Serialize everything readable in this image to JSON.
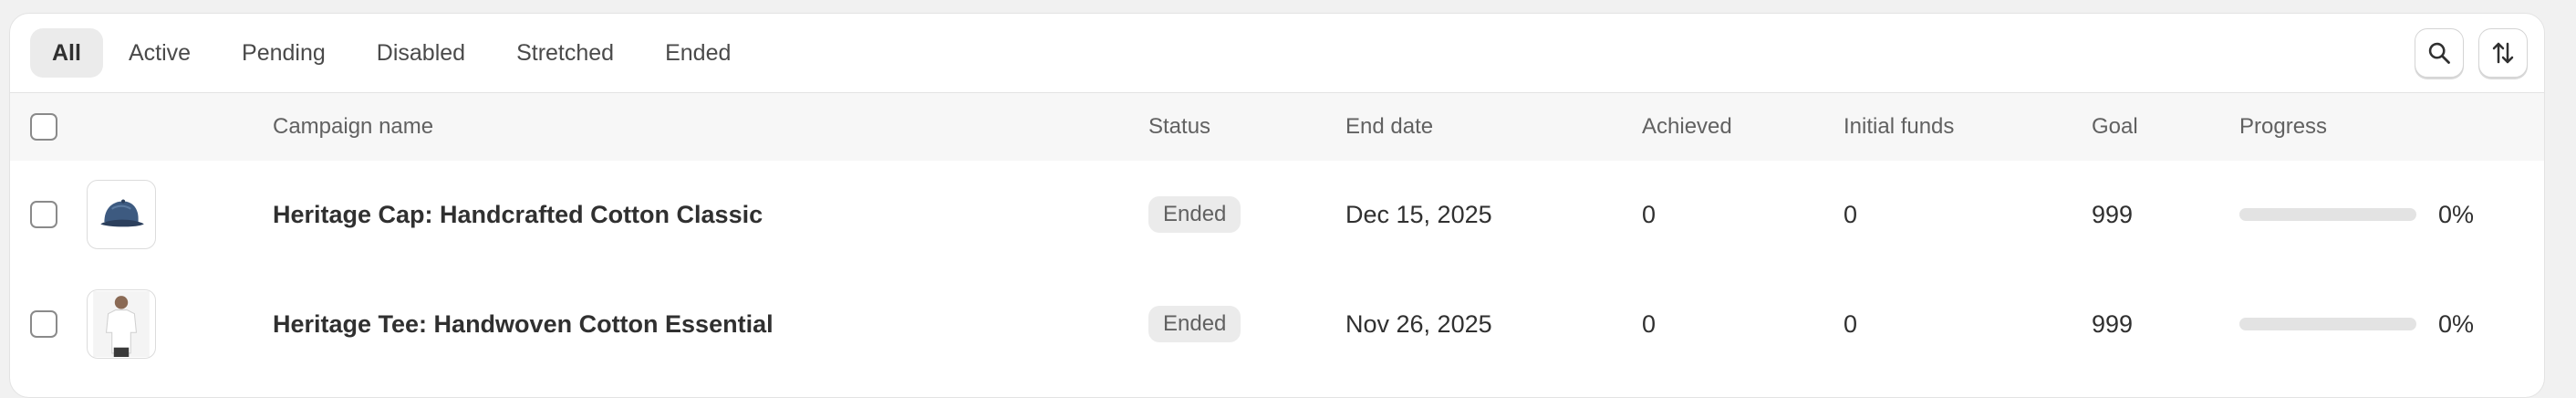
{
  "tabs": [
    {
      "label": "All",
      "active": true
    },
    {
      "label": "Active",
      "active": false
    },
    {
      "label": "Pending",
      "active": false
    },
    {
      "label": "Disabled",
      "active": false
    },
    {
      "label": "Stretched",
      "active": false
    },
    {
      "label": "Ended",
      "active": false
    }
  ],
  "toolbar": {
    "search_icon": "search-icon",
    "sort_icon": "sort-icon"
  },
  "columns": {
    "campaign_name": "Campaign name",
    "status": "Status",
    "end_date": "End date",
    "achieved": "Achieved",
    "initial_funds": "Initial funds",
    "goal": "Goal",
    "progress": "Progress"
  },
  "rows": [
    {
      "thumbnail": "cap-image",
      "name": "Heritage Cap: Handcrafted Cotton Classic",
      "status": "Ended",
      "end_date": "Dec 15, 2025",
      "achieved": "0",
      "initial_funds": "0",
      "goal": "999",
      "progress_label": "0%",
      "progress_fraction": 0
    },
    {
      "thumbnail": "tee-image",
      "name": "Heritage Tee: Handwoven Cotton Essential",
      "status": "Ended",
      "end_date": "Nov 26, 2025",
      "achieved": "0",
      "initial_funds": "0",
      "goal": "999",
      "progress_label": "0%",
      "progress_fraction": 0
    }
  ],
  "colors": {
    "badge_bg": "#ebebeb",
    "header_bg": "#f7f7f7",
    "page_bg": "#f1f1f1"
  }
}
